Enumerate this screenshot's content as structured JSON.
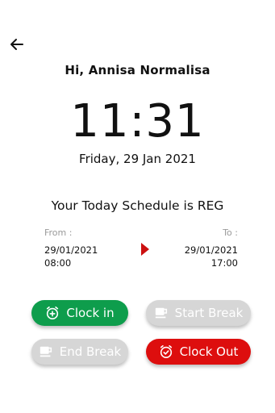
{
  "header": {
    "greeting": "Hi, Annisa Normalisa"
  },
  "clock": {
    "time": "11:31",
    "date": "Friday, 29 Jan 2021"
  },
  "schedule": {
    "title": "Your Today Schedule is REG",
    "from_label": "From :",
    "from_date": "29/01/2021",
    "from_time": "08:00",
    "to_label": "To :",
    "to_date": "29/01/2021",
    "to_time": "17:00"
  },
  "actions": {
    "clock_in": "Clock in",
    "start_break": "Start Break",
    "end_break": "End Break",
    "clock_out": "Clock Out"
  },
  "colors": {
    "clock_in": "#0e9d4c",
    "clock_out": "#dd0e0e",
    "disabled": "#d6d6d6",
    "arrow": "#cc1111"
  },
  "icons": {
    "back": "arrow-left-icon",
    "clock_in": "alarm-plus-icon",
    "start_break": "coffee-cup-icon",
    "end_break": "coffee-cup-icon",
    "clock_out": "alarm-check-icon",
    "range": "play-triangle-icon"
  }
}
